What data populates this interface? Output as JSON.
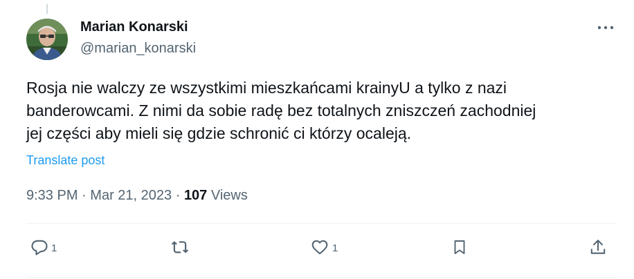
{
  "author": {
    "display_name": "Marian Konarski",
    "handle": "@marian_konarski"
  },
  "tweet": {
    "text": "Rosja nie walczy ze wszystkimi mieszkańcami krainyU a tylko z nazi\nbanderowcami. Z nimi da sobie radę bez totalnych zniszczeń zachodniej\njej części aby mieli się gdzie schronić ci którzy ocaleją.",
    "translate_label": "Translate post",
    "time": "9:33 PM",
    "date": "Mar 21, 2023",
    "separator": "·",
    "views_count": "107",
    "views_label": "Views"
  },
  "actions": {
    "reply": {
      "icon": "reply-icon",
      "count": "1"
    },
    "repost": {
      "icon": "repost-icon",
      "count": ""
    },
    "like": {
      "icon": "heart-icon",
      "count": "1"
    },
    "bookmark": {
      "icon": "bookmark-icon"
    },
    "share": {
      "icon": "share-icon"
    }
  },
  "icons": {
    "more": "more-dots-icon"
  },
  "colors": {
    "text_primary": "#0f1419",
    "text_secondary": "#536471",
    "link": "#1d9bf0",
    "divider": "#eff3f4"
  }
}
